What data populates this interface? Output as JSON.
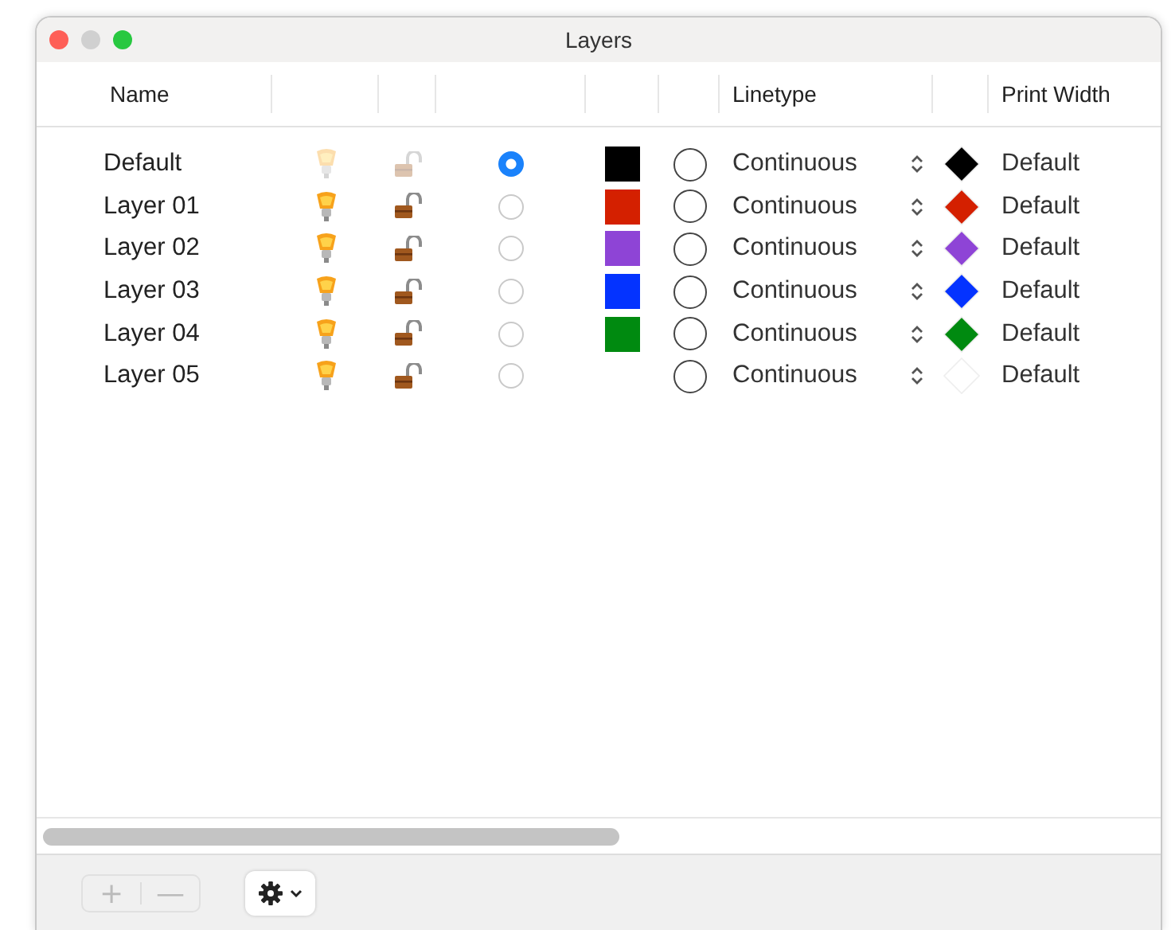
{
  "window": {
    "title": "Layers"
  },
  "table": {
    "columns": [
      "Name",
      "Linetype",
      "Print Width"
    ],
    "rows": [
      {
        "name": "Default",
        "icons_enabled": false,
        "selected": true,
        "color": "#000000",
        "linetype": "Continuous",
        "print_width": "Default"
      },
      {
        "name": "Layer 01",
        "icons_enabled": true,
        "selected": false,
        "color": "#d42000",
        "linetype": "Continuous",
        "print_width": "Default"
      },
      {
        "name": "Layer 02",
        "icons_enabled": true,
        "selected": false,
        "color": "#8e44d6",
        "linetype": "Continuous",
        "print_width": "Default"
      },
      {
        "name": "Layer 03",
        "icons_enabled": true,
        "selected": false,
        "color": "#0433ff",
        "linetype": "Continuous",
        "print_width": "Default"
      },
      {
        "name": "Layer 04",
        "icons_enabled": true,
        "selected": false,
        "color": "#008a10",
        "linetype": "Continuous",
        "print_width": "Default"
      },
      {
        "name": "Layer 05",
        "icons_enabled": true,
        "selected": false,
        "color": "#ffffff",
        "linetype": "Continuous",
        "print_width": "Default"
      }
    ]
  },
  "footer": {
    "add": "+",
    "remove": "—",
    "add_disabled": true,
    "remove_disabled": true
  }
}
